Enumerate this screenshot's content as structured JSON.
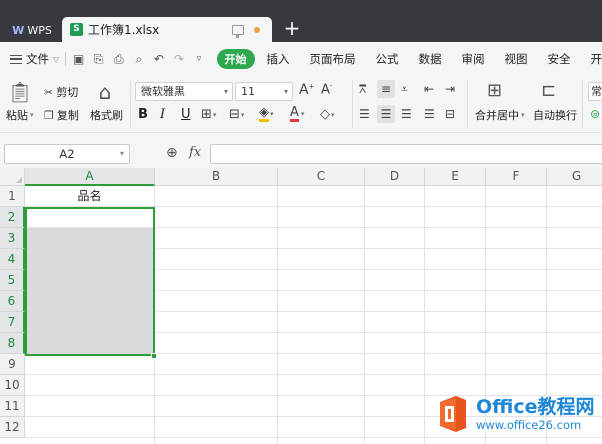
{
  "titlebar": {
    "app_tab": "WPS",
    "app_logo": "W",
    "doc_tab_title": "工作簿1.xlsx",
    "new_tab": "+"
  },
  "menubar": {
    "file_menu": "文件",
    "start_button": "开始",
    "tabs": [
      "插入",
      "页面布局",
      "公式",
      "数据",
      "审阅",
      "视图",
      "安全",
      "开"
    ]
  },
  "ribbon": {
    "paste": "粘贴",
    "cut": "剪切",
    "copy": "复制",
    "format_painter": "格式刷",
    "font_name": "微软雅黑",
    "font_size": "11",
    "bold": "B",
    "italic": "I",
    "underline": "U",
    "merge_center": "合并居中",
    "wrap_text": "自动换行",
    "overflow_label": "常"
  },
  "formula_bar": {
    "name_box": "A2",
    "fx": "fx",
    "formula": ""
  },
  "sheet": {
    "columns": [
      "A",
      "B",
      "C",
      "D",
      "E",
      "F",
      "G"
    ],
    "rows": [
      "1",
      "2",
      "3",
      "4",
      "5",
      "6",
      "7",
      "8",
      "9",
      "10",
      "11",
      "12"
    ],
    "cell_A1": "品名",
    "active_column": "A",
    "selection": "A2:A8",
    "selection_color": "#2f9c3c"
  },
  "watermark": {
    "name": "Office教程网",
    "url": "www.office26.com"
  },
  "colors": {
    "titlebar": "#38383f",
    "start_button": "#2fa84f",
    "selection": "#2f9c3c",
    "watermark": "#1f88d6"
  }
}
